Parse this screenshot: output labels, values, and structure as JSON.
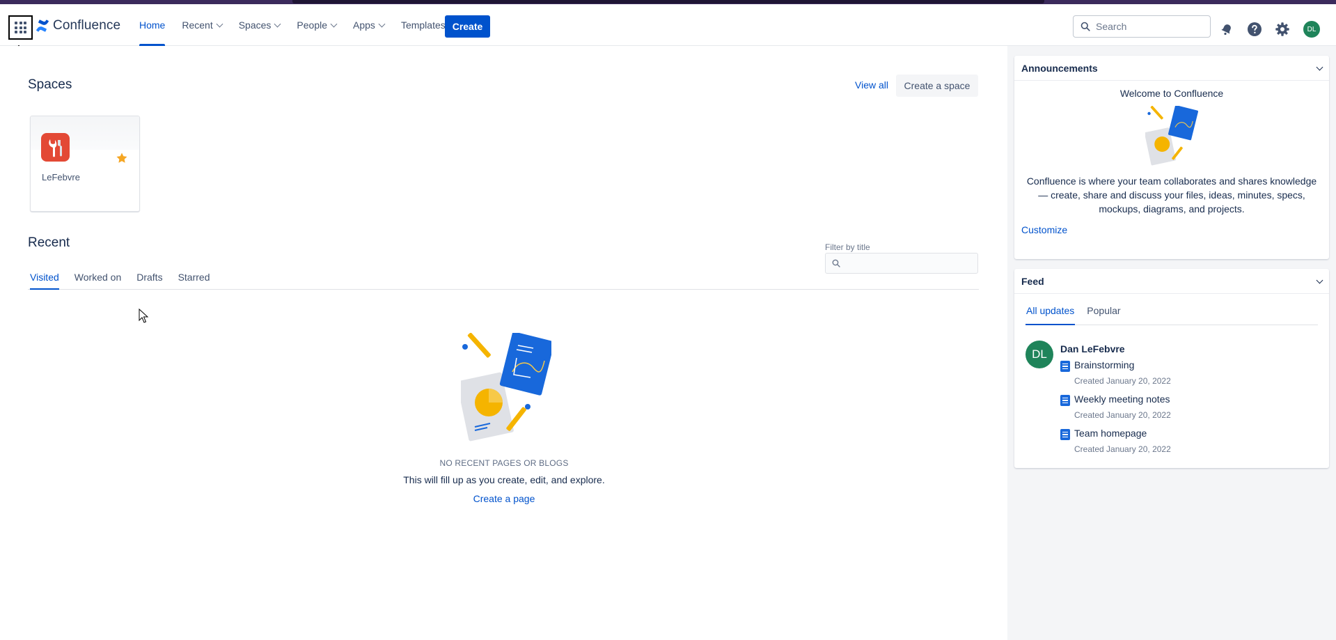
{
  "header": {
    "app_switcher_icon": "app-grid-icon",
    "logo_text": "Confluence",
    "nav": [
      {
        "label": "Home",
        "active": true,
        "dropdown": false
      },
      {
        "label": "Recent",
        "active": false,
        "dropdown": true
      },
      {
        "label": "Spaces",
        "active": false,
        "dropdown": true
      },
      {
        "label": "People",
        "active": false,
        "dropdown": true
      },
      {
        "label": "Apps",
        "active": false,
        "dropdown": true
      },
      {
        "label": "Templates",
        "active": false,
        "dropdown": false
      }
    ],
    "create_label": "Create",
    "search_placeholder": "Search",
    "icons": [
      "notifications-icon",
      "help-icon",
      "settings-icon"
    ],
    "avatar_initials": "DL"
  },
  "annotation": {
    "label": "app-switcher"
  },
  "spaces": {
    "title": "Spaces",
    "view_all": "View all",
    "create_space": "Create a space",
    "cards": [
      {
        "name": "LeFebvre",
        "starred": true
      }
    ]
  },
  "recent": {
    "title": "Recent",
    "tabs": [
      "Visited",
      "Worked on",
      "Drafts",
      "Starred"
    ],
    "active_tab": "Visited",
    "filter_label": "Filter by title",
    "filter_value": "",
    "empty_title": "NO RECENT PAGES OR BLOGS",
    "empty_text": "This will fill up as you create, edit, and explore.",
    "empty_link": "Create a page"
  },
  "announcements": {
    "title": "Announcements",
    "welcome": "Welcome to Confluence",
    "text": "Confluence is where your team collaborates and shares knowledge — create, share and discuss your files, ideas, minutes, specs, mockups, diagrams, and projects.",
    "customize": "Customize"
  },
  "feed": {
    "title": "Feed",
    "tabs": [
      "All updates",
      "Popular"
    ],
    "active_tab": "All updates",
    "user": {
      "initials": "DL",
      "name": "Dan LeFebvre"
    },
    "items": [
      {
        "title": "Brainstorming",
        "meta": "Created January 20, 2022"
      },
      {
        "title": "Weekly meeting notes",
        "meta": "Created January 20, 2022"
      },
      {
        "title": "Team homepage",
        "meta": "Created January 20, 2022"
      }
    ]
  },
  "colors": {
    "primary": "#0052cc",
    "sidebar_bg": "#f4f5f7",
    "avatar": "#1f845a",
    "space_icon": "#e34935",
    "star": "#f5a623"
  }
}
